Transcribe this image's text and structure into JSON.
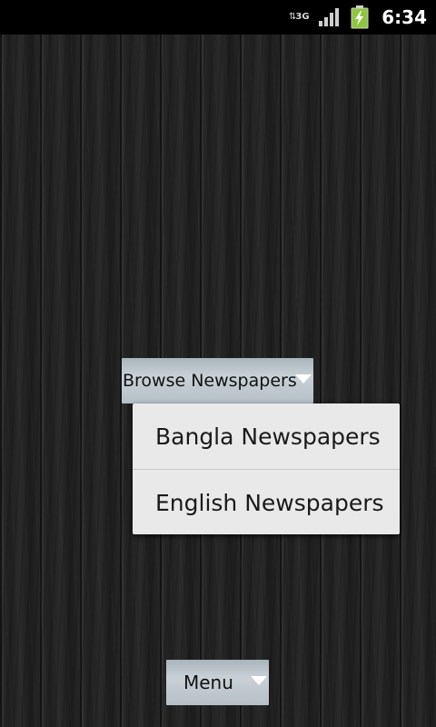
{
  "status_bar": {
    "network_label": "3G",
    "time": "6:34",
    "icons": [
      "data-transfer-icon",
      "signal-strength-icon",
      "battery-charging-icon"
    ]
  },
  "browse": {
    "label": "Browse Newspapers",
    "icon": "chevron-down-icon"
  },
  "dropdown": {
    "items": [
      {
        "label": "Bangla Newspapers"
      },
      {
        "label": "English Newspapers"
      }
    ]
  },
  "menu": {
    "label": "Menu",
    "icon": "chevron-down-icon"
  },
  "colors": {
    "status_bar_bg": "#000000",
    "battery_green": "#8dc63f",
    "spinner_bg": "#c9d1d6",
    "dropdown_bg": "#e9e9e9"
  }
}
